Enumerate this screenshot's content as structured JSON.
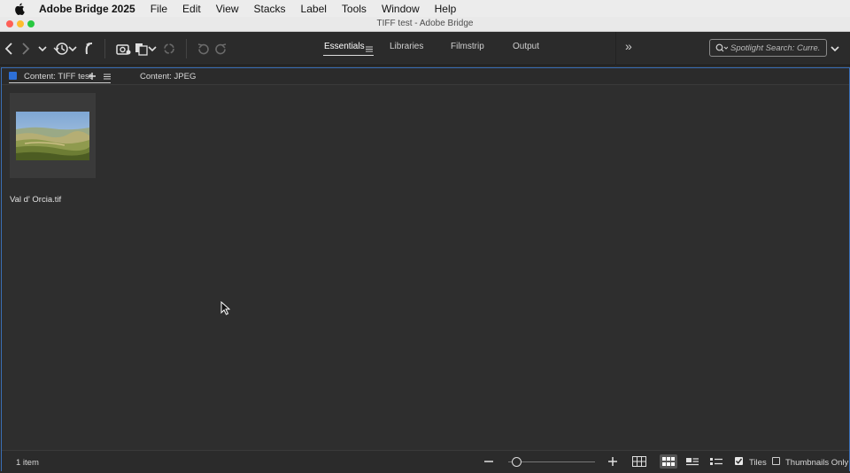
{
  "menubar": {
    "app_name": "Adobe Bridge 2025",
    "items": [
      "File",
      "Edit",
      "View",
      "Stacks",
      "Label",
      "Tools",
      "Window",
      "Help"
    ]
  },
  "window": {
    "title": "TIFF test - Adobe Bridge"
  },
  "toolbar": {
    "workspaces": [
      "Essentials",
      "Libraries",
      "Filmstrip",
      "Output"
    ],
    "active_workspace": "Essentials",
    "more_label": "»",
    "search_placeholder": "Spotlight Search: Curre."
  },
  "panel": {
    "tabs": [
      {
        "label": "Content: TIFF test"
      },
      {
        "label": "Content: JPEG"
      }
    ],
    "items": [
      {
        "filename": "Val d' Orcia.tif"
      }
    ]
  },
  "statusbar": {
    "count_text": "1 item",
    "zoom_fraction": 0.1,
    "tiles_label": "Tiles",
    "tiles_checked": true,
    "thumbnails_only_label": "Thumbnails Only",
    "thumbnails_only_checked": false
  },
  "colors": {
    "accent_blue": "#2d6fd6",
    "panel_border": "#3a6fb6",
    "background": "#2b2b2b"
  }
}
